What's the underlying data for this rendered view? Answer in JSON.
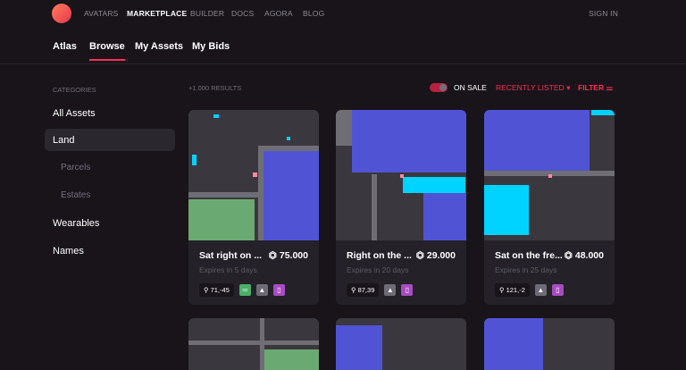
{
  "nav": {
    "items": [
      "AVATARS",
      "MARKETPLACE",
      "BUILDER",
      "DOCS",
      "AGORA",
      "BLOG"
    ],
    "signin": "SIGN IN"
  },
  "tabs": [
    "Atlas",
    "Browse",
    "My Assets",
    "My Bids"
  ],
  "sidebar": {
    "heading": "CATEGORIES",
    "items": [
      "All Assets",
      "Land",
      "Parcels",
      "Estates",
      "Wearables",
      "Names"
    ]
  },
  "toolbar": {
    "results": "+1.000 RESULTS",
    "on_sale": "ON SALE",
    "sort": "RECENTLY LISTED",
    "filter": "FILTER"
  },
  "colors": {
    "accent": "#ff2d55",
    "plaza": "#5054d4",
    "district": "#6aaa72",
    "road": "#6e6e74",
    "owned": "#00d3ff"
  },
  "cards": [
    {
      "title": "Sat right on ...",
      "price": "75.000",
      "expires": "Expires in 5 days",
      "coords": "71,-45"
    },
    {
      "title": "Right on the ...",
      "price": "29.000",
      "expires": "Expires in 20 days",
      "coords": "87,39"
    },
    {
      "title": "Sat on the fre...",
      "price": "48.000",
      "expires": "Expires in 25 days",
      "coords": "121,-2"
    }
  ]
}
